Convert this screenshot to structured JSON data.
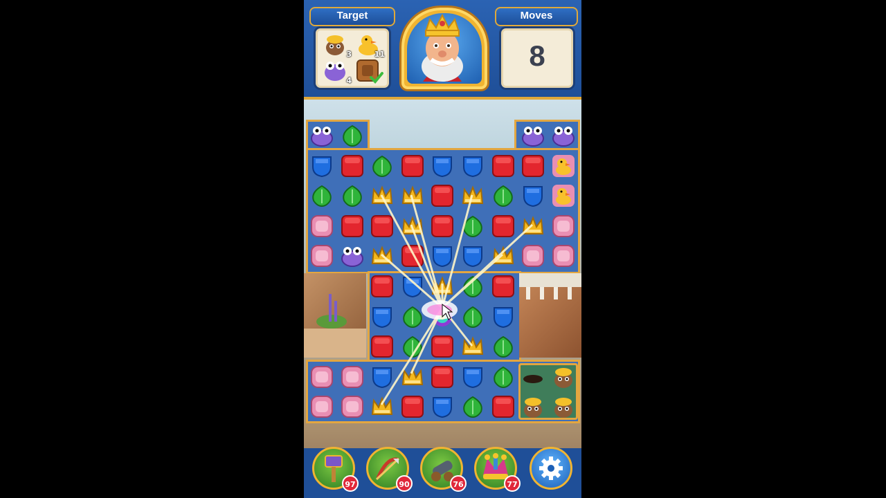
{
  "hud": {
    "target_label": "Target",
    "moves_label": "Moves",
    "moves_value": "8",
    "targets": [
      {
        "icon": "mole-icon",
        "count": "3"
      },
      {
        "icon": "duck-icon",
        "count": "11"
      },
      {
        "icon": "frog-icon",
        "count": "4"
      },
      {
        "icon": "crate-icon",
        "count": "",
        "done": true
      }
    ]
  },
  "boosters": [
    {
      "name": "hammer-booster",
      "icon": "hammer-icon",
      "count": "97"
    },
    {
      "name": "arrow-booster",
      "icon": "arrow-icon",
      "count": "90"
    },
    {
      "name": "cannon-booster",
      "icon": "cannon-icon",
      "count": "76"
    },
    {
      "name": "jester-booster",
      "icon": "jester-hat-icon",
      "count": "77"
    }
  ],
  "settings": {
    "icon": "gear-icon"
  },
  "board": {
    "rows": [
      [
        "frog",
        "leaf",
        "",
        "",
        "",
        "",
        "",
        "frog",
        "frog"
      ],
      [
        "shield",
        "cube",
        "leaf",
        "cube",
        "shield",
        "shield",
        "cube",
        "cube",
        "duck"
      ],
      [
        "leaf",
        "leaf",
        "crown",
        "crown",
        "cube",
        "crown",
        "leaf",
        "shield",
        "duck"
      ],
      [
        "pink",
        "cube",
        "cube",
        "crown",
        "cube",
        "leaf",
        "cube",
        "crown",
        "pink"
      ],
      [
        "pink",
        "frog",
        "crown",
        "cube",
        "shield",
        "shield",
        "crown",
        "pink",
        "pink"
      ],
      [
        "",
        "",
        "cube",
        "shield",
        "crown",
        "leaf",
        "cube",
        "",
        ""
      ],
      [
        "",
        "",
        "shield",
        "leaf",
        "swirl",
        "leaf",
        "shield",
        "",
        ""
      ],
      [
        "",
        "",
        "cube",
        "leaf",
        "cube",
        "crown",
        "leaf",
        "",
        ""
      ],
      [
        "pink",
        "pink",
        "shield",
        "crown",
        "cube",
        "shield",
        "leaf",
        "mole-hole",
        "mole"
      ],
      [
        "pink",
        "pink",
        "crown",
        "cube",
        "shield",
        "leaf",
        "cube",
        "mole",
        "mole"
      ]
    ]
  },
  "colors": {
    "cube": "#e3262e",
    "shield": "#1f6ee0",
    "leaf": "#2fb43a",
    "crown": "#f4b81e",
    "pink": "#e98fb3",
    "frog": "#8a63d6"
  }
}
